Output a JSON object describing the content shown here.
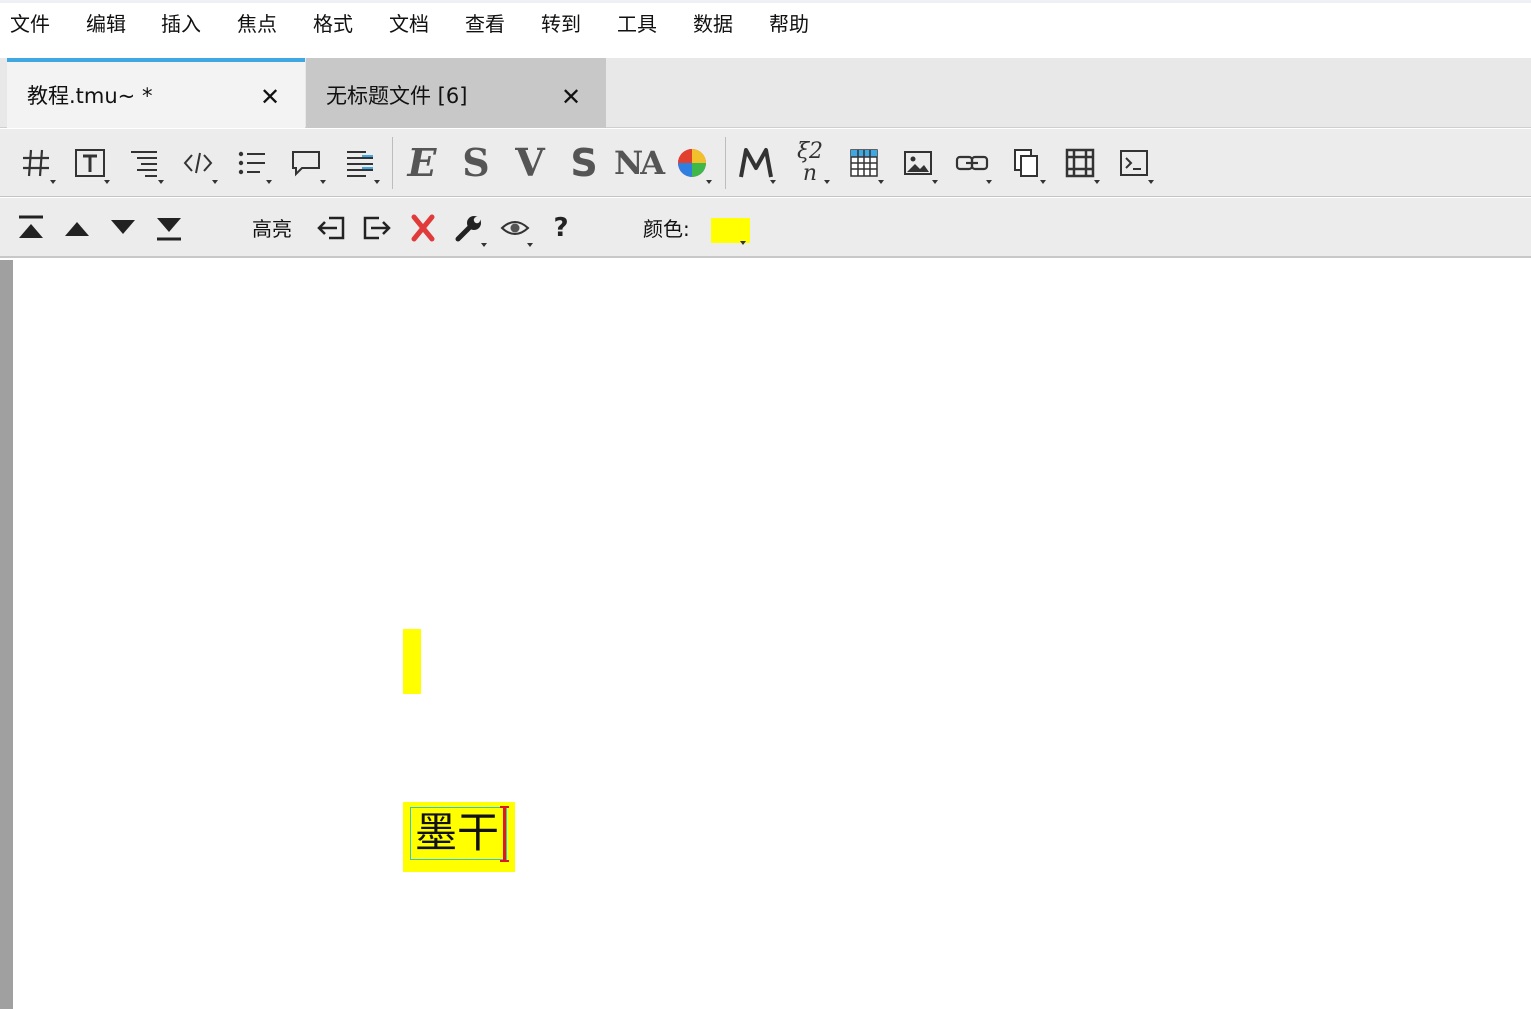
{
  "menubar": {
    "items": [
      "文件",
      "编辑",
      "插入",
      "焦点",
      "格式",
      "文档",
      "查看",
      "转到",
      "工具",
      "数据",
      "帮助"
    ]
  },
  "tabs": [
    {
      "label": "教程.tmu~ *",
      "active": true
    },
    {
      "label": "无标题文件 [6]",
      "active": false
    }
  ],
  "toolbar1": {
    "letter_icons": [
      "E",
      "S",
      "V",
      "S",
      "NA"
    ],
    "formula_label": "ξ2 n"
  },
  "toolbar2": {
    "highlight_label": "高亮",
    "help_label": "?",
    "color_label": "颜色:"
  },
  "document": {
    "highlighted_text": "墨干"
  },
  "colors": {
    "highlight": "#ffff00",
    "tab_active_accent": "#3fa7e1",
    "caret": "#d8192a",
    "delete_icon": "#e03a3a"
  }
}
